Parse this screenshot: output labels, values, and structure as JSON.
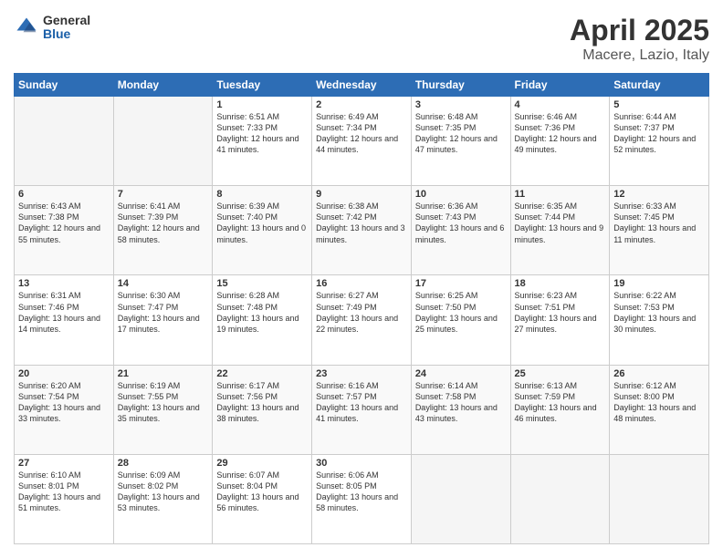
{
  "header": {
    "logo": {
      "general": "General",
      "blue": "Blue"
    },
    "title": "April 2025",
    "subtitle": "Macere, Lazio, Italy"
  },
  "days_of_week": [
    "Sunday",
    "Monday",
    "Tuesday",
    "Wednesday",
    "Thursday",
    "Friday",
    "Saturday"
  ],
  "weeks": [
    [
      {
        "day": "",
        "info": ""
      },
      {
        "day": "",
        "info": ""
      },
      {
        "day": "1",
        "sunrise": "Sunrise: 6:51 AM",
        "sunset": "Sunset: 7:33 PM",
        "daylight": "Daylight: 12 hours and 41 minutes."
      },
      {
        "day": "2",
        "sunrise": "Sunrise: 6:49 AM",
        "sunset": "Sunset: 7:34 PM",
        "daylight": "Daylight: 12 hours and 44 minutes."
      },
      {
        "day": "3",
        "sunrise": "Sunrise: 6:48 AM",
        "sunset": "Sunset: 7:35 PM",
        "daylight": "Daylight: 12 hours and 47 minutes."
      },
      {
        "day": "4",
        "sunrise": "Sunrise: 6:46 AM",
        "sunset": "Sunset: 7:36 PM",
        "daylight": "Daylight: 12 hours and 49 minutes."
      },
      {
        "day": "5",
        "sunrise": "Sunrise: 6:44 AM",
        "sunset": "Sunset: 7:37 PM",
        "daylight": "Daylight: 12 hours and 52 minutes."
      }
    ],
    [
      {
        "day": "6",
        "sunrise": "Sunrise: 6:43 AM",
        "sunset": "Sunset: 7:38 PM",
        "daylight": "Daylight: 12 hours and 55 minutes."
      },
      {
        "day": "7",
        "sunrise": "Sunrise: 6:41 AM",
        "sunset": "Sunset: 7:39 PM",
        "daylight": "Daylight: 12 hours and 58 minutes."
      },
      {
        "day": "8",
        "sunrise": "Sunrise: 6:39 AM",
        "sunset": "Sunset: 7:40 PM",
        "daylight": "Daylight: 13 hours and 0 minutes."
      },
      {
        "day": "9",
        "sunrise": "Sunrise: 6:38 AM",
        "sunset": "Sunset: 7:42 PM",
        "daylight": "Daylight: 13 hours and 3 minutes."
      },
      {
        "day": "10",
        "sunrise": "Sunrise: 6:36 AM",
        "sunset": "Sunset: 7:43 PM",
        "daylight": "Daylight: 13 hours and 6 minutes."
      },
      {
        "day": "11",
        "sunrise": "Sunrise: 6:35 AM",
        "sunset": "Sunset: 7:44 PM",
        "daylight": "Daylight: 13 hours and 9 minutes."
      },
      {
        "day": "12",
        "sunrise": "Sunrise: 6:33 AM",
        "sunset": "Sunset: 7:45 PM",
        "daylight": "Daylight: 13 hours and 11 minutes."
      }
    ],
    [
      {
        "day": "13",
        "sunrise": "Sunrise: 6:31 AM",
        "sunset": "Sunset: 7:46 PM",
        "daylight": "Daylight: 13 hours and 14 minutes."
      },
      {
        "day": "14",
        "sunrise": "Sunrise: 6:30 AM",
        "sunset": "Sunset: 7:47 PM",
        "daylight": "Daylight: 13 hours and 17 minutes."
      },
      {
        "day": "15",
        "sunrise": "Sunrise: 6:28 AM",
        "sunset": "Sunset: 7:48 PM",
        "daylight": "Daylight: 13 hours and 19 minutes."
      },
      {
        "day": "16",
        "sunrise": "Sunrise: 6:27 AM",
        "sunset": "Sunset: 7:49 PM",
        "daylight": "Daylight: 13 hours and 22 minutes."
      },
      {
        "day": "17",
        "sunrise": "Sunrise: 6:25 AM",
        "sunset": "Sunset: 7:50 PM",
        "daylight": "Daylight: 13 hours and 25 minutes."
      },
      {
        "day": "18",
        "sunrise": "Sunrise: 6:23 AM",
        "sunset": "Sunset: 7:51 PM",
        "daylight": "Daylight: 13 hours and 27 minutes."
      },
      {
        "day": "19",
        "sunrise": "Sunrise: 6:22 AM",
        "sunset": "Sunset: 7:53 PM",
        "daylight": "Daylight: 13 hours and 30 minutes."
      }
    ],
    [
      {
        "day": "20",
        "sunrise": "Sunrise: 6:20 AM",
        "sunset": "Sunset: 7:54 PM",
        "daylight": "Daylight: 13 hours and 33 minutes."
      },
      {
        "day": "21",
        "sunrise": "Sunrise: 6:19 AM",
        "sunset": "Sunset: 7:55 PM",
        "daylight": "Daylight: 13 hours and 35 minutes."
      },
      {
        "day": "22",
        "sunrise": "Sunrise: 6:17 AM",
        "sunset": "Sunset: 7:56 PM",
        "daylight": "Daylight: 13 hours and 38 minutes."
      },
      {
        "day": "23",
        "sunrise": "Sunrise: 6:16 AM",
        "sunset": "Sunset: 7:57 PM",
        "daylight": "Daylight: 13 hours and 41 minutes."
      },
      {
        "day": "24",
        "sunrise": "Sunrise: 6:14 AM",
        "sunset": "Sunset: 7:58 PM",
        "daylight": "Daylight: 13 hours and 43 minutes."
      },
      {
        "day": "25",
        "sunrise": "Sunrise: 6:13 AM",
        "sunset": "Sunset: 7:59 PM",
        "daylight": "Daylight: 13 hours and 46 minutes."
      },
      {
        "day": "26",
        "sunrise": "Sunrise: 6:12 AM",
        "sunset": "Sunset: 8:00 PM",
        "daylight": "Daylight: 13 hours and 48 minutes."
      }
    ],
    [
      {
        "day": "27",
        "sunrise": "Sunrise: 6:10 AM",
        "sunset": "Sunset: 8:01 PM",
        "daylight": "Daylight: 13 hours and 51 minutes."
      },
      {
        "day": "28",
        "sunrise": "Sunrise: 6:09 AM",
        "sunset": "Sunset: 8:02 PM",
        "daylight": "Daylight: 13 hours and 53 minutes."
      },
      {
        "day": "29",
        "sunrise": "Sunrise: 6:07 AM",
        "sunset": "Sunset: 8:04 PM",
        "daylight": "Daylight: 13 hours and 56 minutes."
      },
      {
        "day": "30",
        "sunrise": "Sunrise: 6:06 AM",
        "sunset": "Sunset: 8:05 PM",
        "daylight": "Daylight: 13 hours and 58 minutes."
      },
      {
        "day": "",
        "info": ""
      },
      {
        "day": "",
        "info": ""
      },
      {
        "day": "",
        "info": ""
      }
    ]
  ]
}
